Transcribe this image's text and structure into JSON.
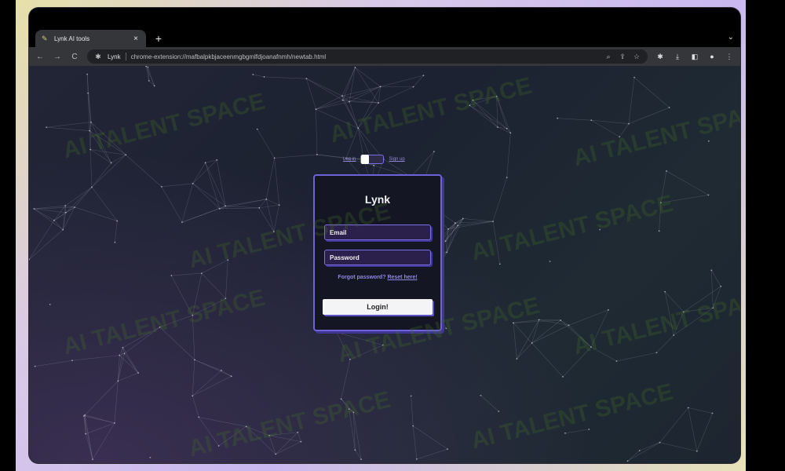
{
  "browser": {
    "tab": {
      "title": "Lynk AI tools",
      "close": "×"
    },
    "new_tab": "+",
    "tab_menu": "⌄",
    "nav": {
      "back": "←",
      "forward": "→",
      "reload": "C"
    },
    "omnibox": {
      "site_name": "Lynk",
      "url": "chrome-extension://mafbalpkbjaceenmgbgmlfdjoanafnmh/newtab.html"
    },
    "toolbar_icons": [
      "zoom-icon",
      "share-icon",
      "star-icon",
      "extensions-icon",
      "download-icon",
      "sidepanel-icon",
      "profile-icon",
      "menu-icon"
    ]
  },
  "auth": {
    "toggle": {
      "login_label": "Log in",
      "signup_label": "Sign up",
      "state": "login"
    },
    "title": "Lynk",
    "email_placeholder": "Email",
    "password_placeholder": "Password",
    "forgot_text": "Forgot password?",
    "reset_link": "Reset here!",
    "submit_label": "Login!"
  },
  "watermark": "AI TALENT SPACE"
}
